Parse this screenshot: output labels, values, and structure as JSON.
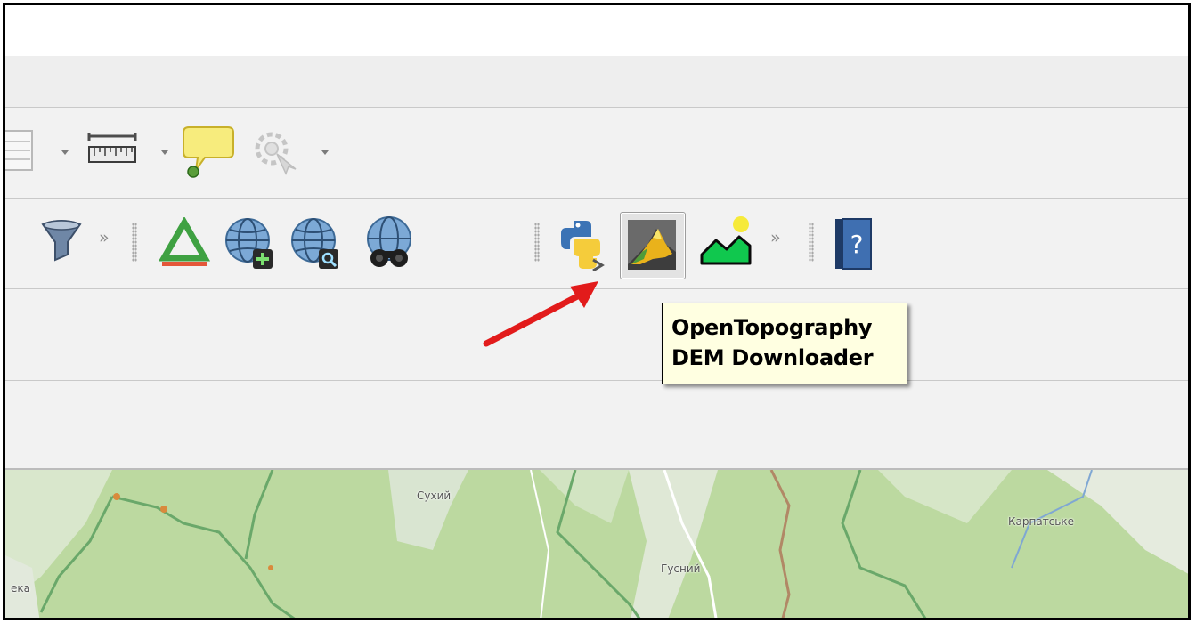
{
  "tooltip": {
    "line1": "OpenTopography",
    "line2": "DEM Downloader"
  },
  "toolbar_top": {
    "icons": [
      "attribute-table-icon",
      "measure-ruler-icon",
      "annotation-callout-icon",
      "identify-features-icon"
    ]
  },
  "toolbar_plugins": {
    "overflow_glyph": "»",
    "icons": [
      "filter-funnel-icon",
      "digitize-triangle-icon",
      "add-wms-layer-icon",
      "zoom-wms-icon",
      "search-binoculars-icon",
      "python-console-icon",
      "opentopography-dem-icon",
      "terrain-profile-icon",
      "help-book-icon"
    ],
    "active_button": "opentopography-dem-icon",
    "help_glyph": "?"
  },
  "map": {
    "labels": [
      "Сухий",
      "Карпатське",
      "Гусний",
      "ека"
    ]
  },
  "colors": {
    "tooltip_bg": "#ffffe1",
    "arrow": "#e21b1b",
    "toolbar_bg": "#f2f2f2",
    "map_forest": "#bcd9a0"
  }
}
